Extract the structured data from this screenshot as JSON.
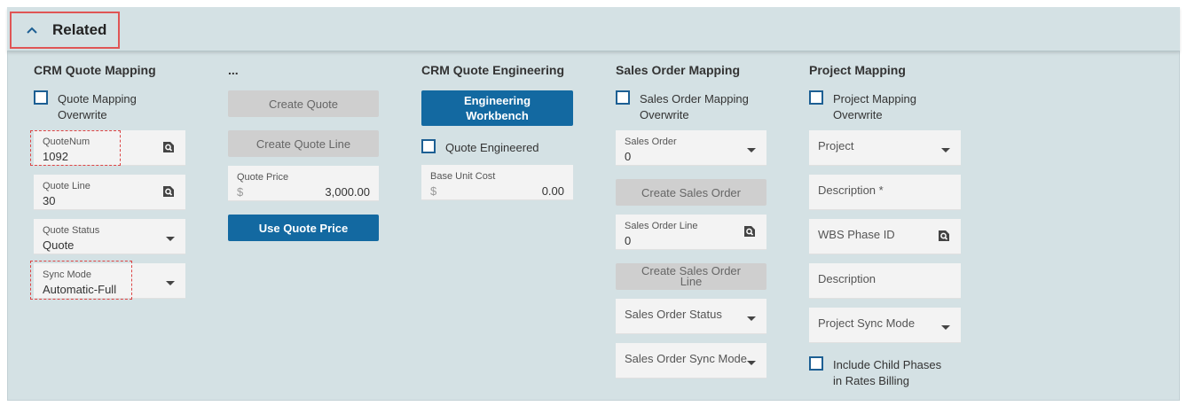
{
  "header": {
    "title": "Related"
  },
  "crm_quote_mapping": {
    "title": "CRM Quote Mapping",
    "overwrite_label_1": "Quote Mapping",
    "overwrite_label_2": "Overwrite",
    "quotenum": {
      "label": "QuoteNum",
      "value": "1092"
    },
    "quote_line": {
      "label": "Quote Line",
      "value": "30"
    },
    "quote_status": {
      "label": "Quote Status",
      "value": "Quote"
    },
    "sync_mode": {
      "label": "Sync Mode",
      "value": "Automatic-Full"
    }
  },
  "quote_actions": {
    "title": "...",
    "create_quote": "Create Quote",
    "create_quote_line": "Create Quote Line",
    "quote_price": {
      "label": "Quote Price",
      "currency": "$",
      "value": "3,000.00"
    },
    "use_quote_price": "Use Quote Price"
  },
  "crm_quote_engineering": {
    "title": "CRM Quote Engineering",
    "workbench_line1": "Engineering",
    "workbench_line2": "Workbench",
    "quote_engineered": "Quote Engineered",
    "base_unit_cost": {
      "label": "Base Unit Cost",
      "currency": "$",
      "value": "0.00"
    }
  },
  "sales_order_mapping": {
    "title": "Sales Order Mapping",
    "overwrite_label_1": "Sales Order Mapping",
    "overwrite_label_2": "Overwrite",
    "sales_order": {
      "label": "Sales Order",
      "value": "0"
    },
    "create_sales_order": "Create Sales Order",
    "sales_order_line": {
      "label": "Sales Order Line",
      "value": "0"
    },
    "create_sales_order_line_1": "Create Sales Order",
    "create_sales_order_line_2": "Line",
    "sales_order_status": "Sales Order Status",
    "sales_order_sync_mode": "Sales Order Sync Mode"
  },
  "project_mapping": {
    "title": "Project Mapping",
    "overwrite_label_1": "Project Mapping",
    "overwrite_label_2": "Overwrite",
    "project": "Project",
    "description_required": "Description *",
    "wbs_phase_id": "WBS Phase ID",
    "description": "Description",
    "project_sync_mode": "Project Sync Mode",
    "include_child_1": "Include Child Phases",
    "include_child_2": "in Rates Billing"
  },
  "colors": {
    "accent": "#1369a1",
    "panel": "#d4e1e4",
    "highlight": "#e05555"
  },
  "icons": {
    "collapse": "chevron-up-icon",
    "lookup": "magnifier-icon",
    "dropdown": "caret-down-icon"
  }
}
